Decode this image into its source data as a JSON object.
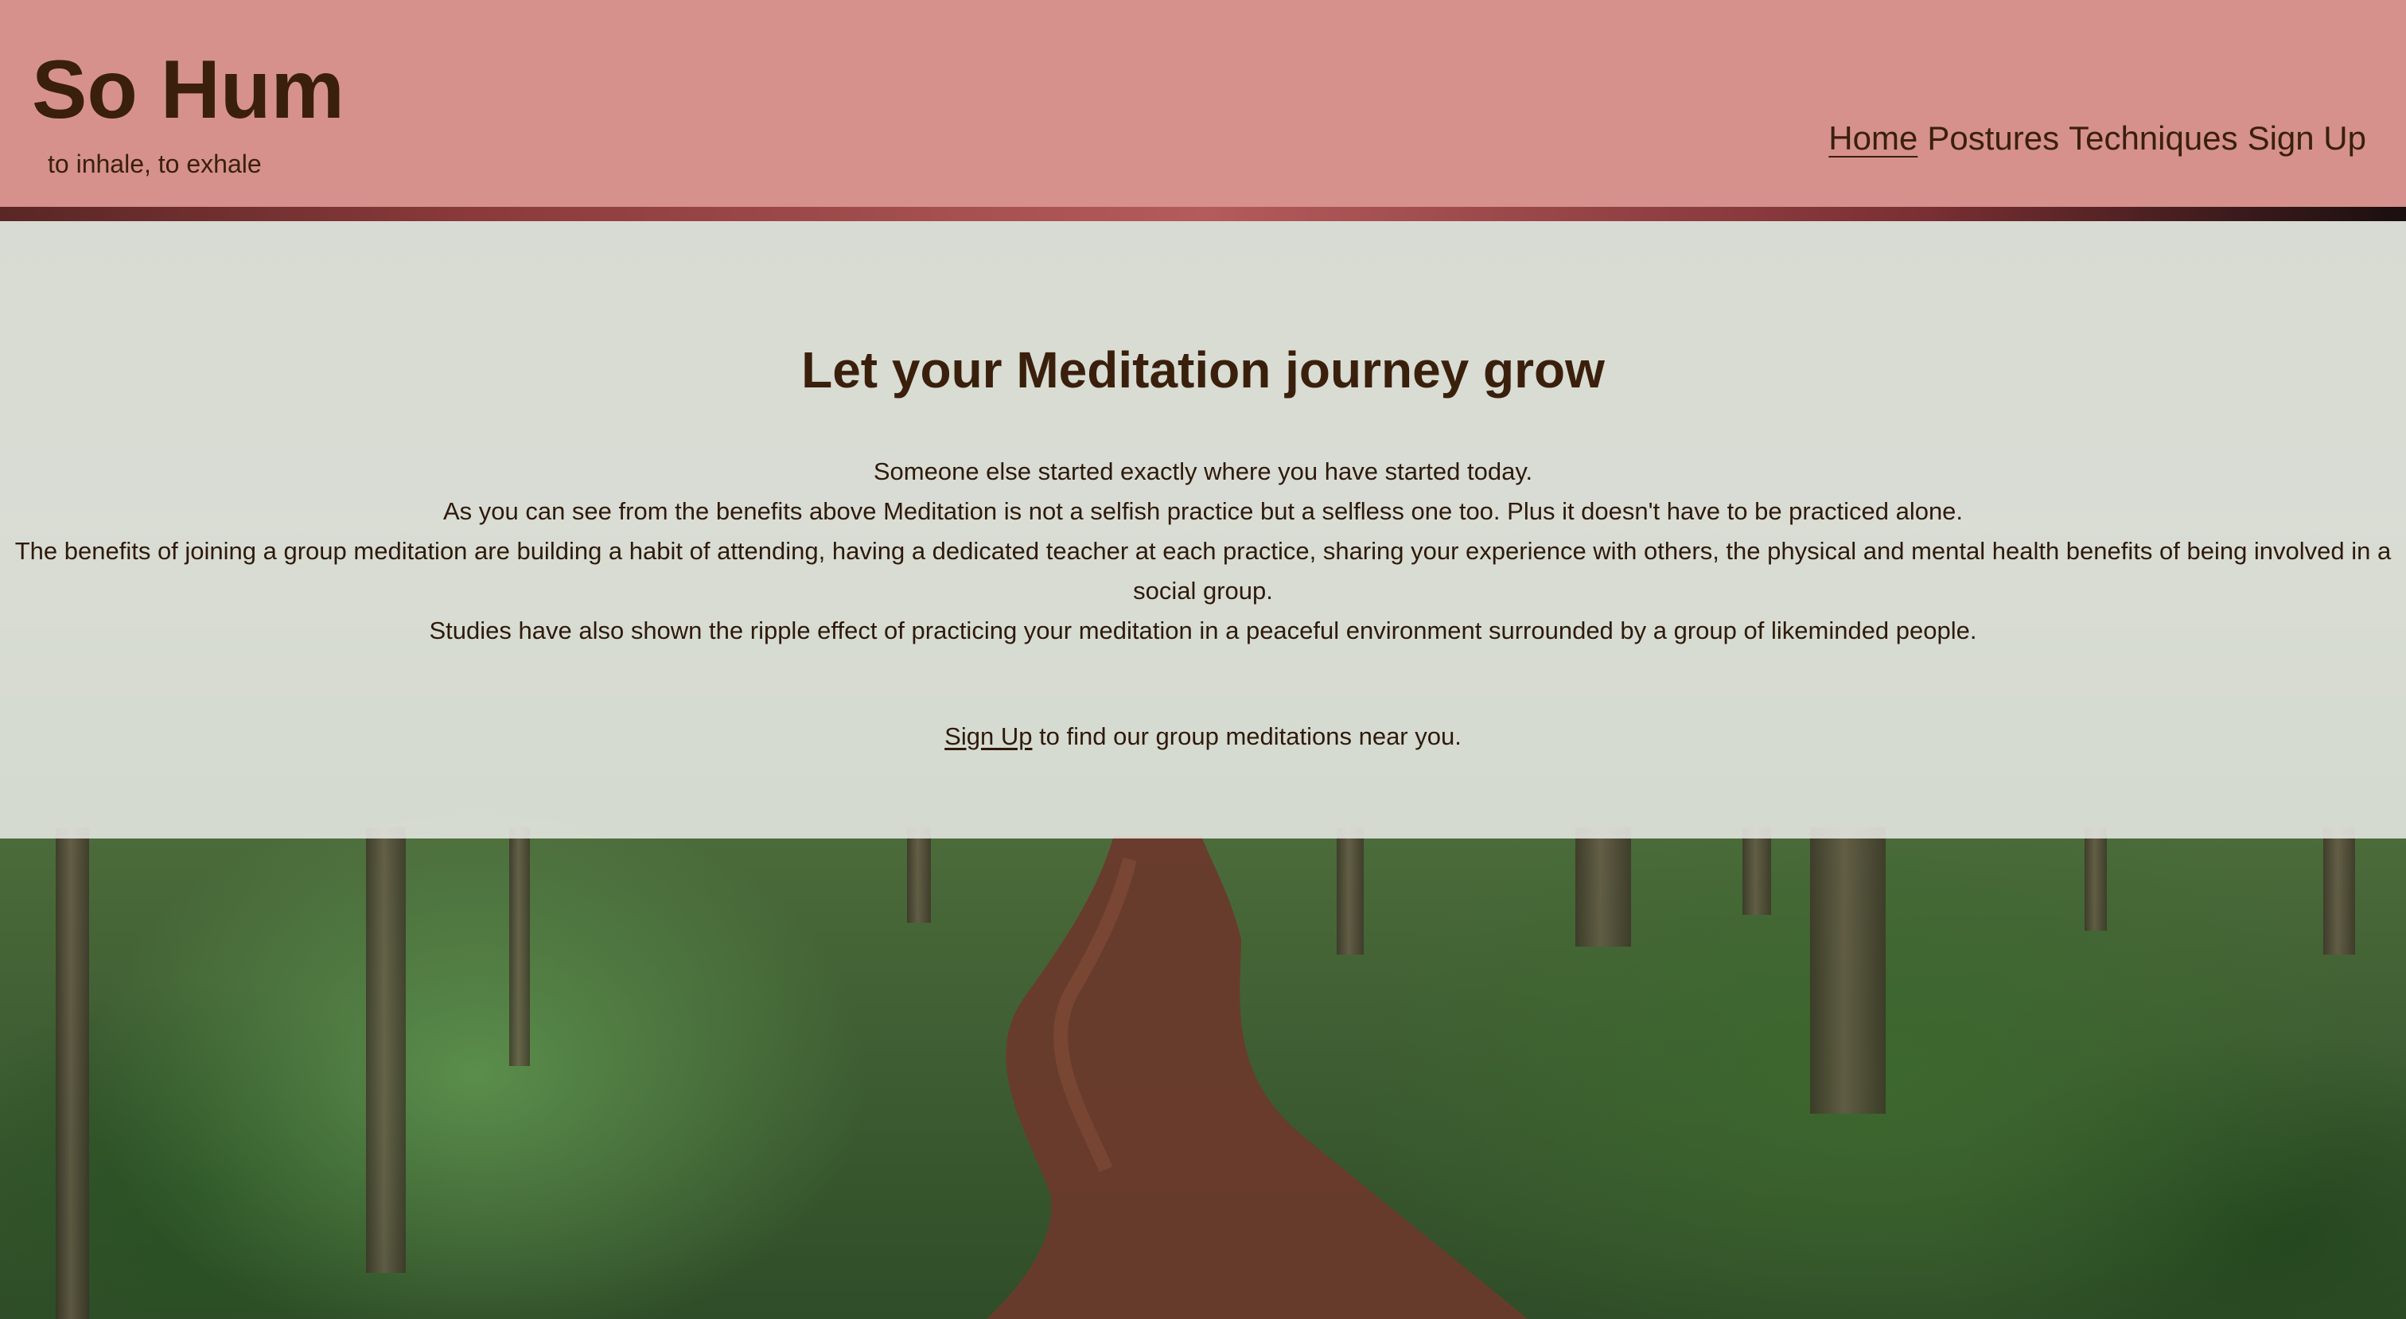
{
  "site": {
    "title": "So Hum",
    "tagline": "to inhale, to exhale"
  },
  "nav": {
    "items": [
      {
        "label": "Home",
        "active": true
      },
      {
        "label": "Postures",
        "active": false
      },
      {
        "label": "Techniques",
        "active": false
      },
      {
        "label": "Sign Up",
        "active": false
      }
    ]
  },
  "main": {
    "heading": "Let your Meditation journey grow",
    "paragraphs": [
      "Someone else started exactly where you have started today.",
      "As you can see from the benefits above Meditation is not a selfish practice but a selfless one too. Plus it doesn't have to be practiced alone.",
      "The benefits of joining a group meditation are building a habit of attending, having a dedicated teacher at each practice, sharing your experience with others, the physical and mental health benefits of being involved in a social group.",
      "Studies have also shown the ripple effect of practicing your meditation in a peaceful environment surrounded by a group of likeminded people."
    ],
    "cta": {
      "link_label": "Sign Up",
      "rest": " to find our group meditations near you."
    }
  },
  "colors": {
    "header_bg": "#d6918d",
    "text_dark_brown": "#3a200c",
    "panel_bg": "#ebece9"
  },
  "background": {
    "image": "forest-path"
  }
}
